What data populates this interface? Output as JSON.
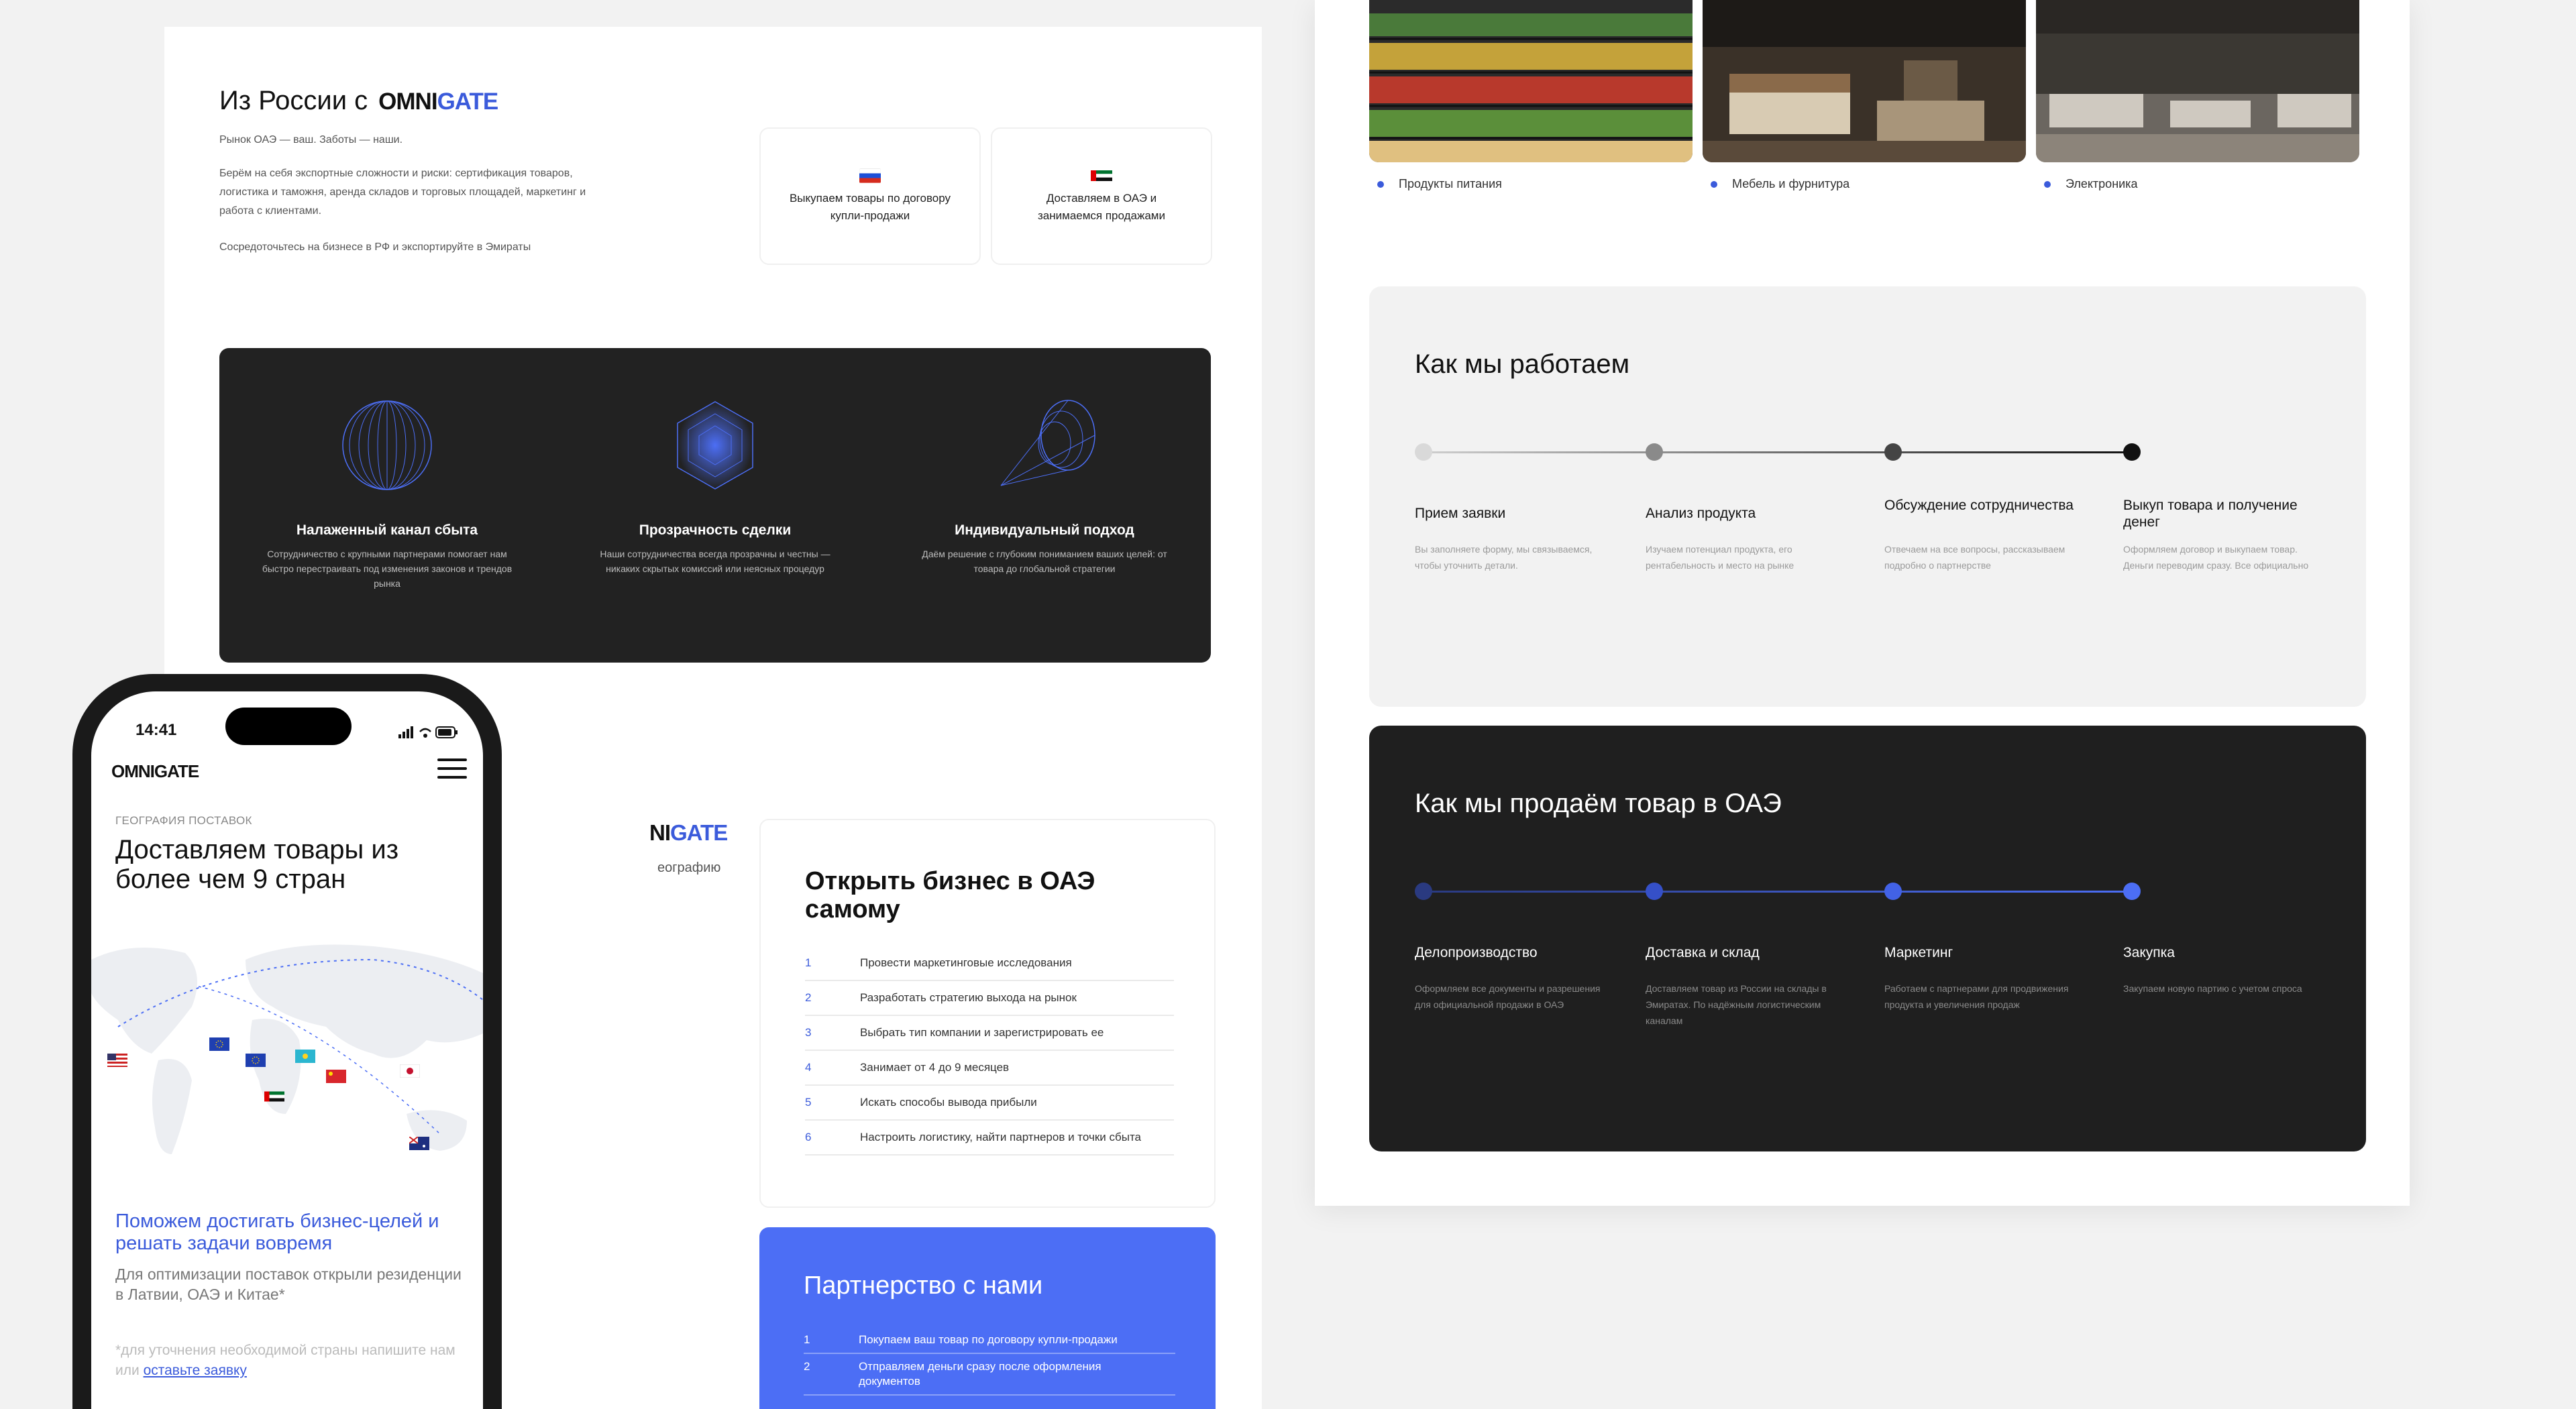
{
  "left_page": {
    "hero": {
      "title_prefix": "Из России с",
      "brand_a": "OMNI",
      "brand_b": "GATE",
      "lead": "Рынок ОАЭ — ваш. Заботы — наши.",
      "body": "Берём на себя экспортные сложности и риски: сертификация товаров, логистика и таможня, аренда складов и торговых площадей, маркетинг и работа с клиентами.",
      "footer": "Сосредоточьтесь на бизнесе в РФ и экспортируйте в Эмираты"
    },
    "flag_cards": [
      {
        "flag": "russia-flag-icon",
        "text": "Выкупаем товары по договору купли-продажи"
      },
      {
        "flag": "uae-flag-icon",
        "text": "Доставляем в ОАЭ и занимаемся продажами"
      }
    ],
    "features": [
      {
        "icon": "sphere-icon",
        "title": "Налаженный канал сбыта",
        "text": "Сотрудничество с крупными партнерами помогает нам быстро перестраивать под изменения законов и трендов рынка"
      },
      {
        "icon": "hexagon-icon",
        "title": "Прозрачность сделки",
        "text": "Наши сотрудничества всегда прозрачны и честны — никаких скрытых комиссий или неясных процедур"
      },
      {
        "icon": "cone-icon",
        "title": "Индивидуальный подход",
        "text": "Даём решение с глубоким пониманием ваших целей: от товара до глобальной стратегии"
      }
    ],
    "partial_brand": "NIGATE",
    "partial_text": "еографию",
    "open_business": {
      "title": "Открыть бизнес в ОАЭ самому",
      "steps": [
        {
          "n": "1",
          "text": "Провести маркетинговые исследования"
        },
        {
          "n": "2",
          "text": "Разработать стратегию выхода на рынок"
        },
        {
          "n": "3",
          "text": "Выбрать тип компании и зарегистрировать ее"
        },
        {
          "n": "4",
          "text": "Занимает от 4 до 9 месяцев"
        },
        {
          "n": "5",
          "text": "Искать способы вывода прибыли"
        },
        {
          "n": "6",
          "text": "Настроить логистику, найти партнеров и точки сбыта"
        }
      ]
    },
    "partnership": {
      "title": "Партнерство с нами",
      "steps": [
        {
          "n": "1",
          "text": "Покупаем ваш товар по договору купли-продажи"
        },
        {
          "n": "2",
          "text": "Отправляем деньги сразу после оформления документов"
        }
      ]
    }
  },
  "phone": {
    "time": "14:41",
    "logo": "OMNIGATE",
    "eyebrow": "ГЕОГРАФИЯ ПОСТАВОК",
    "title": "Доставляем товары из более чем 9 стран",
    "blue_text": "Поможем достигать бизнес-целей и решать задачи вовремя",
    "grey_text": "Для оптимизации поставок открыли резиденции в Латвии, ОАЭ и Китае*",
    "note_prefix": "*для уточнения необходимой страны напишите нам или",
    "note_link": "оставьте заявку",
    "map_flags": [
      "usa-flag-icon",
      "eu-flag-icon",
      "eu-flag-icon",
      "kazakhstan-flag-icon",
      "china-flag-icon",
      "japan-flag-icon",
      "uae-flag-icon",
      "australia-flag-icon"
    ]
  },
  "right_page": {
    "categories": [
      {
        "label": "Продукты питания"
      },
      {
        "label": "Мебель и фурнитура"
      },
      {
        "label": "Электроника"
      }
    ],
    "how_we_work": {
      "title": "Как мы работаем",
      "steps": [
        {
          "title": "Прием заявки",
          "text": "Вы заполняете форму, мы связываемся, чтобы уточнить детали."
        },
        {
          "title": "Анализ продукта",
          "text": "Изучаем потенциал продукта, его рентабельность и место на рынке"
        },
        {
          "title": "Обсуждение сотрудничества",
          "text": "Отвечаем на все вопросы, рассказываем подробно о партнерстве"
        },
        {
          "title": "Выкуп товара и получение денег",
          "text": "Оформляем договор и выкупаем товар. Деньги переводим сразу. Все официально"
        }
      ]
    },
    "how_we_sell": {
      "title": "Как мы продаём товар в ОАЭ",
      "steps": [
        {
          "title": "Делопроизводство",
          "text": "Оформляем все документы и разрешения для официальной продажи в ОАЭ"
        },
        {
          "title": "Доставка и склад",
          "text": "Доставляем товар из России на склады в Эмиратах. По надёжным логистическим каналам"
        },
        {
          "title": "Маркетинг",
          "text": "Работаем с партнерами для продвижения продукта и увеличения продаж"
        },
        {
          "title": "Закупка",
          "text": "Закупаем новую партию с учетом спроса"
        }
      ]
    }
  },
  "colors": {
    "accent": "#3b5bdb",
    "dark": "#222222",
    "partner_blue": "#4c6ef5"
  }
}
